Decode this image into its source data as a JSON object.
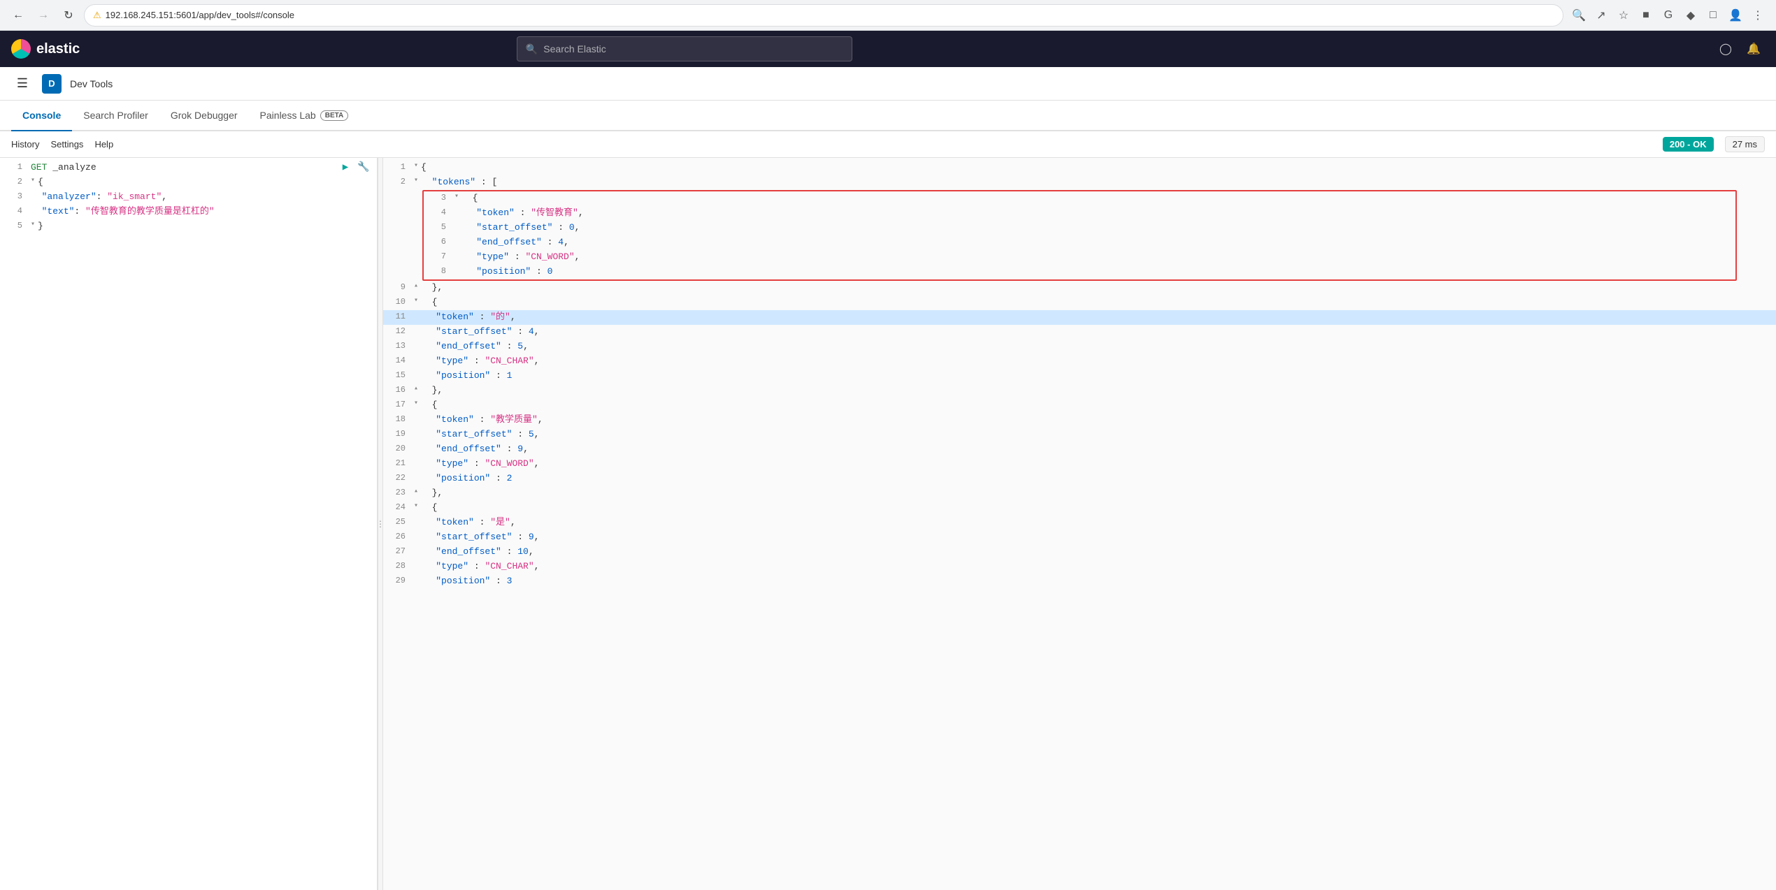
{
  "browser": {
    "url": "192.168.245.151:5601/app/dev_tools#/console",
    "security_label": "不安全",
    "back_disabled": false,
    "forward_disabled": true
  },
  "header": {
    "logo_text": "elastic",
    "search_placeholder": "Search Elastic",
    "search_value": ""
  },
  "sub_header": {
    "app_initial": "D",
    "breadcrumb": "Dev Tools"
  },
  "tabs": [
    {
      "id": "console",
      "label": "Console",
      "active": true,
      "beta": false
    },
    {
      "id": "search-profiler",
      "label": "Search Profiler",
      "active": false,
      "beta": false
    },
    {
      "id": "grok-debugger",
      "label": "Grok Debugger",
      "active": false,
      "beta": false
    },
    {
      "id": "painless-lab",
      "label": "Painless Lab",
      "active": false,
      "beta": true
    }
  ],
  "toolbar": {
    "history_label": "History",
    "settings_label": "Settings",
    "help_label": "Help",
    "status": "200 - OK",
    "time": "27 ms"
  },
  "editor": {
    "lines": [
      {
        "num": 1,
        "content": "GET _analyze",
        "type": "keyword",
        "has_actions": true
      },
      {
        "num": 2,
        "content": "{",
        "type": "punct",
        "fold": true
      },
      {
        "num": 3,
        "content": "  \"analyzer\": \"ik_smart\",",
        "type": "code"
      },
      {
        "num": 4,
        "content": "  \"text\": \"传智教育的教学质量是杠杠的\"",
        "type": "code"
      },
      {
        "num": 5,
        "content": "}",
        "type": "punct",
        "fold": true
      }
    ]
  },
  "results": {
    "lines": [
      {
        "num": 1,
        "content": "{",
        "fold": true,
        "indent": 0
      },
      {
        "num": 2,
        "content": "  \"tokens\" : [",
        "fold": true,
        "indent": 1
      },
      {
        "num": 3,
        "content": "  {",
        "fold": true,
        "indent": 1,
        "red_box_start": true
      },
      {
        "num": 4,
        "content": "    \"token\" : \"传智教育\",",
        "indent": 2,
        "red_box": true
      },
      {
        "num": 5,
        "content": "    \"start_offset\" : 0,",
        "indent": 2,
        "red_box": true
      },
      {
        "num": 6,
        "content": "    \"end_offset\" : 4,",
        "indent": 2,
        "red_box": true
      },
      {
        "num": 7,
        "content": "    \"type\" : \"CN_WORD\",",
        "indent": 2,
        "red_box": true
      },
      {
        "num": 8,
        "content": "    \"position\" : 0",
        "indent": 2,
        "red_box": true,
        "red_box_end": true
      },
      {
        "num": 9,
        "content": "  },",
        "fold": true,
        "indent": 1
      },
      {
        "num": 10,
        "content": "  {",
        "fold": true,
        "indent": 1
      },
      {
        "num": 11,
        "content": "    \"token\" : \"的\",",
        "indent": 2,
        "highlighted": true
      },
      {
        "num": 12,
        "content": "    \"start_offset\" : 4,",
        "indent": 2
      },
      {
        "num": 13,
        "content": "    \"end_offset\" : 5,",
        "indent": 2
      },
      {
        "num": 14,
        "content": "    \"type\" : \"CN_CHAR\",",
        "indent": 2
      },
      {
        "num": 15,
        "content": "    \"position\" : 1",
        "indent": 2
      },
      {
        "num": 16,
        "content": "  },",
        "fold": true,
        "indent": 1
      },
      {
        "num": 17,
        "content": "  {",
        "fold": true,
        "indent": 1
      },
      {
        "num": 18,
        "content": "    \"token\" : \"教学质量\",",
        "indent": 2
      },
      {
        "num": 19,
        "content": "    \"start_offset\" : 5,",
        "indent": 2
      },
      {
        "num": 20,
        "content": "    \"end_offset\" : 9,",
        "indent": 2
      },
      {
        "num": 21,
        "content": "    \"type\" : \"CN_WORD\",",
        "indent": 2
      },
      {
        "num": 22,
        "content": "    \"position\" : 2",
        "indent": 2
      },
      {
        "num": 23,
        "content": "  },",
        "fold": true,
        "indent": 1
      },
      {
        "num": 24,
        "content": "  {",
        "fold": true,
        "indent": 1
      },
      {
        "num": 25,
        "content": "    \"token\" : \"是\",",
        "indent": 2
      },
      {
        "num": 26,
        "content": "    \"start_offset\" : 9,",
        "indent": 2
      },
      {
        "num": 27,
        "content": "    \"end_offset\" : 10,",
        "indent": 2
      },
      {
        "num": 28,
        "content": "    \"type\" : \"CN_CHAR\",",
        "indent": 2
      },
      {
        "num": 29,
        "content": "    \"position\" : 3",
        "indent": 2
      }
    ]
  }
}
